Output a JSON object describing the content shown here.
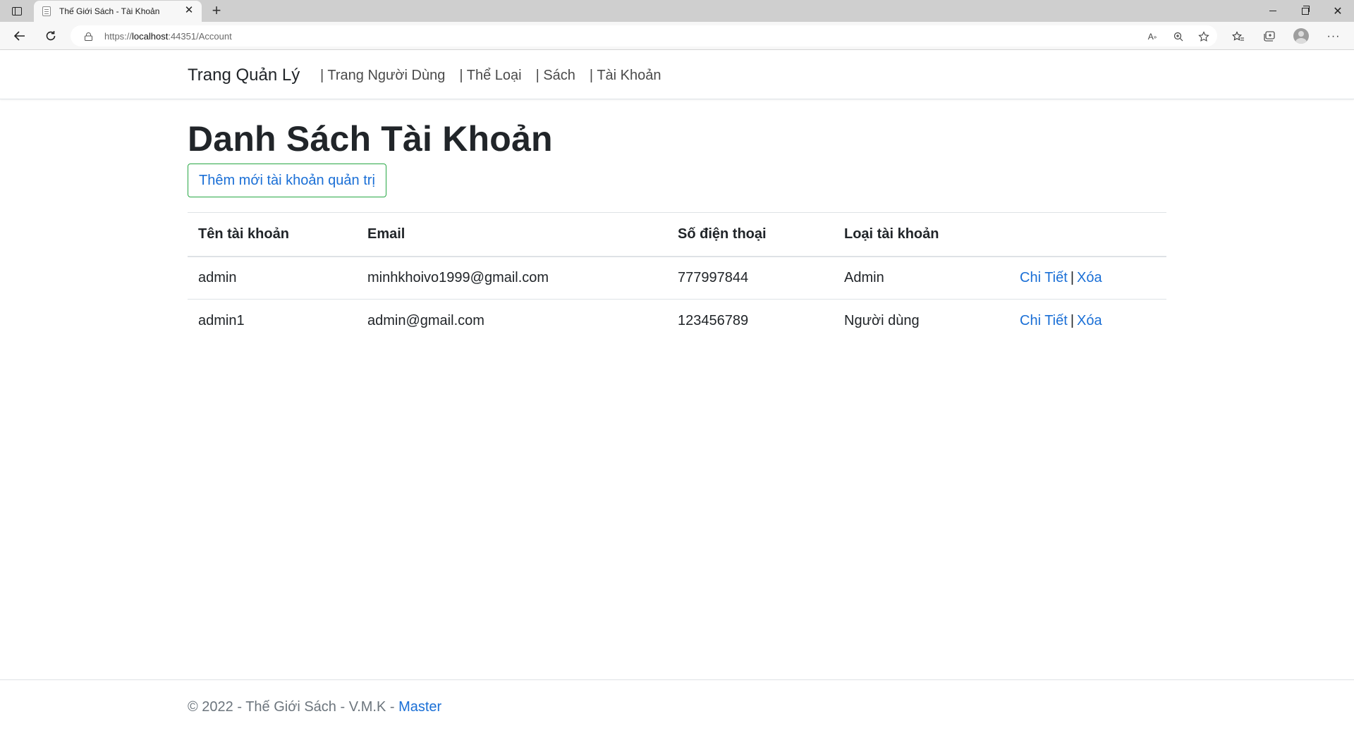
{
  "browser": {
    "tab_title": "Thế Giới Sách - Tài Khoản",
    "url_scheme": "https://",
    "url_host": "localhost",
    "url_rest": ":44351/Account"
  },
  "navbar": {
    "brand": "Trang Quản Lý",
    "links": [
      "| Trang Người Dùng",
      "| Thể Loại",
      "| Sách",
      "| Tài Khoản"
    ]
  },
  "main": {
    "title": "Danh Sách Tài Khoản",
    "add_button": "Thêm mới tài khoản quản trị",
    "table": {
      "headers": [
        "Tên tài khoản",
        "Email",
        "Số điện thoại",
        "Loại tài khoản",
        ""
      ],
      "rows": [
        {
          "username": "admin",
          "email": "minhkhoivo1999@gmail.com",
          "phone": "777997844",
          "type": "Admin",
          "detail": "Chi Tiết",
          "separator": "|",
          "delete": "Xóa"
        },
        {
          "username": "admin1",
          "email": "admin@gmail.com",
          "phone": "123456789",
          "type": "Người dùng",
          "detail": "Chi Tiết",
          "separator": "|",
          "delete": "Xóa"
        }
      ]
    }
  },
  "footer": {
    "text": "© 2022 - Thế Giới Sách - V.M.K - ",
    "link": "Master"
  },
  "colors": {
    "link": "#1a6fd6",
    "button_border": "#28a745",
    "footer_text": "#6c757d"
  }
}
